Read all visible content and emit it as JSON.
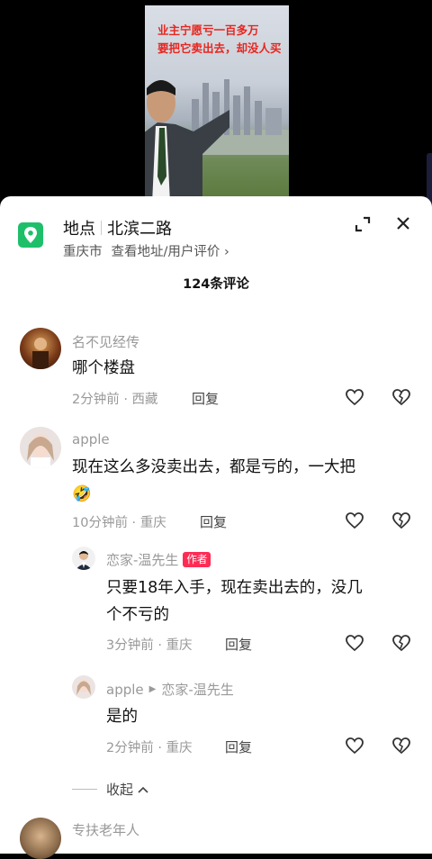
{
  "video": {
    "overlay_line1": "业主宁愿亏一百多万",
    "overlay_line2": "要把它卖出去，却没人买"
  },
  "location": {
    "label": "地点",
    "name": "北滨二路",
    "city": "重庆市",
    "links": "查看地址/用户评价",
    "accent_color": "#1fbf6a"
  },
  "comments_count": "124条评论",
  "comments": [
    {
      "user": "名不见经传",
      "text": "哪个楼盘",
      "meta": "2分钟前 · 西藏",
      "reply": "回复"
    },
    {
      "user": "apple",
      "text_line1": "现在这么多没卖出去，都是亏的，一大把",
      "emoji": "🤣",
      "meta": "10分钟前 · 重庆",
      "reply": "回复"
    },
    {
      "user": "恋家-温先生",
      "tag": "作者",
      "text_line1": "只要18年入手，现在卖出去的，没几",
      "text_line2": "个不亏的",
      "meta": "3分钟前 · 重庆",
      "reply": "回复"
    },
    {
      "user": "apple",
      "reply_to": "恋家-温先生",
      "text": "是的",
      "meta": "2分钟前 · 重庆",
      "reply": "回复"
    },
    {
      "user": "专扶老年人"
    }
  ],
  "collapse_label": "收起"
}
